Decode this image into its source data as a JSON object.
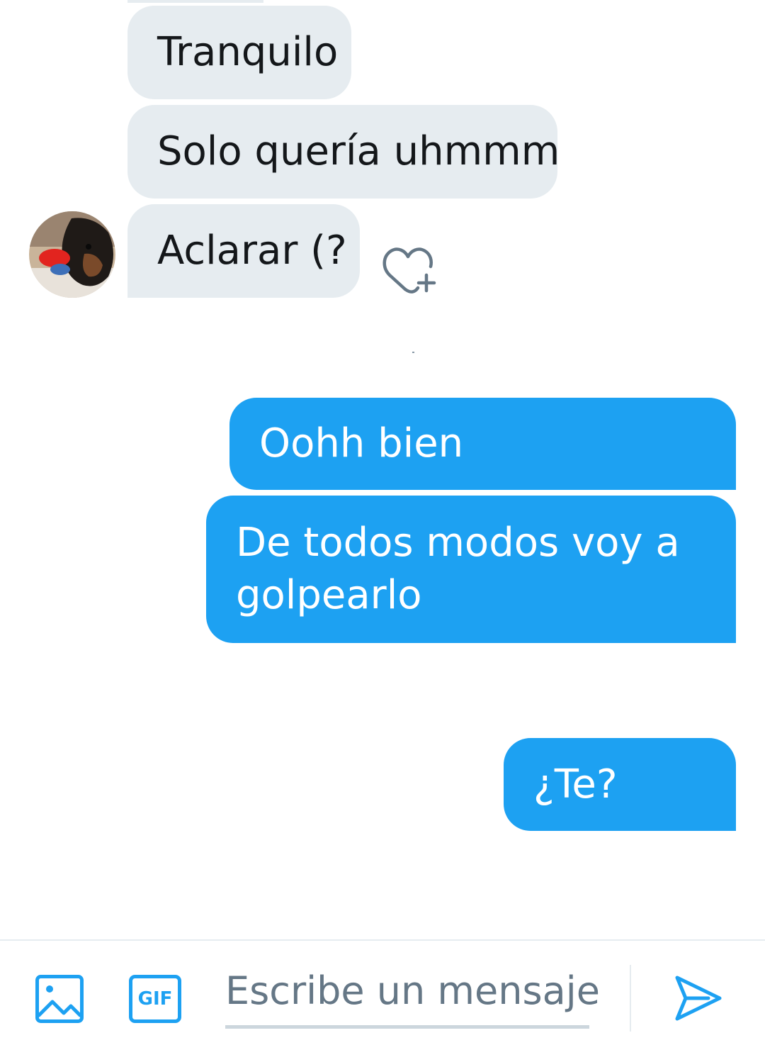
{
  "conversation": {
    "received": [
      {
        "text": "Tranquilo"
      },
      {
        "text": "Solo quería uhmmm"
      },
      {
        "text": "Aclarar (?"
      }
    ],
    "sent": [
      {
        "text": "Oohh bien"
      },
      {
        "text": "De todos modos voy a"
      },
      {
        "text": "golpearlo"
      },
      {
        "text": "¿Te?"
      }
    ]
  },
  "composer": {
    "placeholder": "Escribe un mensaje",
    "gif_label": "GIF",
    "icons": [
      "image-icon",
      "gif-icon",
      "send-icon"
    ]
  },
  "message_actions": {
    "icons": [
      "heart-plus-icon"
    ]
  },
  "colors": {
    "accent": "#1da1f2",
    "received_bubble": "#e6ecf0",
    "received_text": "#14171a",
    "placeholder_text": "#657786"
  }
}
